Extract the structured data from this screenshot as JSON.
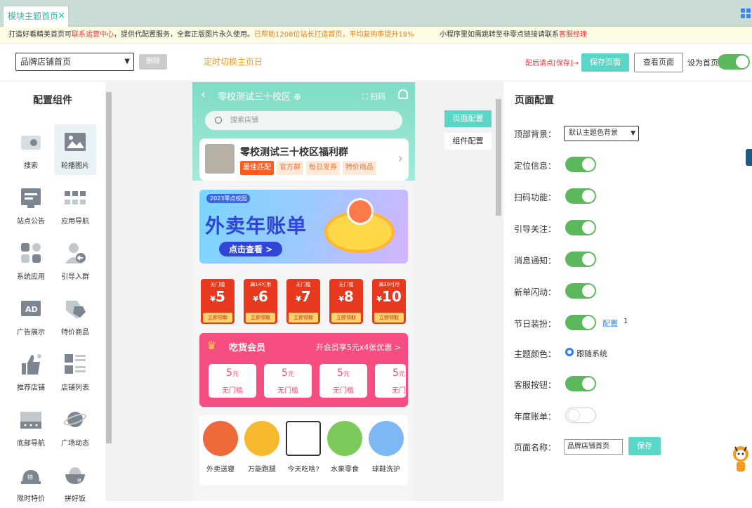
{
  "tabbar": {
    "tab_label": "模块主题首页",
    "close_glyph": "×",
    "accent": "#2bb6a8"
  },
  "notice": {
    "p1": "打造好看精美首页可",
    "p2": "联系运营中心",
    "p3": "，提供代配置服务，全套正版图片永久使用。",
    "p4": "已帮助1208位站长打造首页，平均复购率提升18%",
    "p5": "小程序里如需跳转至非零点链接请联系",
    "p6": "客服经理"
  },
  "toolbar": {
    "page_select": "品牌店铺首页",
    "delete": "删除",
    "timer_link": "定时切换主页日",
    "hint": "配后请点[保存]→",
    "save": "保存页面",
    "view": "查看页面",
    "set_home": "设为首页"
  },
  "left": {
    "title": "配置组件",
    "items": [
      {
        "label": "搜索",
        "icon": "search-component-icon"
      },
      {
        "label": "轮播图片",
        "icon": "image-carousel-icon"
      },
      {
        "label": "站点公告",
        "icon": "announcement-icon"
      },
      {
        "label": "应用导航",
        "icon": "app-nav-icon"
      },
      {
        "label": "系统应用",
        "icon": "system-app-icon"
      },
      {
        "label": "引导入群",
        "icon": "join-group-icon"
      },
      {
        "label": "广告展示",
        "icon": "ad-icon"
      },
      {
        "label": "特价商品",
        "icon": "price-tag-icon"
      },
      {
        "label": "推荐店铺",
        "icon": "thumbs-up-icon"
      },
      {
        "label": "店铺列表",
        "icon": "shop-list-icon"
      },
      {
        "label": "底部导航",
        "icon": "bottom-nav-icon"
      },
      {
        "label": "广场动态",
        "icon": "planet-icon"
      },
      {
        "label": "限时特价",
        "icon": "bell-special-icon"
      },
      {
        "label": "拼好饭",
        "icon": "bowl-icon"
      }
    ]
  },
  "phone": {
    "title": "零校测试三十校区",
    "scan": "扫码",
    "search_placeholder": "搜索店铺",
    "group_title": "零校测试三十校区福利群",
    "group_tags": [
      "最佳匹配",
      "官方群",
      "每日发券",
      "特价商品"
    ],
    "banner_sub": "2023零点校园",
    "banner_title": "外卖年账单",
    "banner_cta": "点击查看 >",
    "coupons": [
      {
        "cond": "无门槛",
        "value": "5",
        "btn": "立即领取"
      },
      {
        "cond": "满14可用",
        "value": "6",
        "btn": "立即领取"
      },
      {
        "cond": "无门槛",
        "value": "7",
        "btn": "立即领取"
      },
      {
        "cond": "无门槛",
        "value": "8",
        "btn": "立即领取"
      },
      {
        "cond": "满30可用",
        "value": "10",
        "btn": "立即领取"
      }
    ],
    "currency": "¥",
    "member_title": "吃货会员",
    "member_right": "开会员享5元x4张优惠 >",
    "member_coupons": [
      {
        "value": "5",
        "unit": "元",
        "desc": "无门槛"
      },
      {
        "value": "5",
        "unit": "元",
        "desc": "无门槛"
      },
      {
        "value": "5",
        "unit": "元",
        "desc": "无门槛"
      },
      {
        "value": "5",
        "unit": "元",
        "desc": "无门"
      }
    ],
    "services": [
      {
        "label": "外卖送寝",
        "color": "#ef6a3a"
      },
      {
        "label": "万能跑腿",
        "color": "#f7b92d"
      },
      {
        "label": "今天吃啥?",
        "color": "#ffffff"
      },
      {
        "label": "水果零食",
        "color": "#7ccb5a"
      },
      {
        "label": "球鞋洗护",
        "color": "#7db8f5"
      }
    ]
  },
  "preview_tabs": {
    "page": "页面配置",
    "component": "组件配置"
  },
  "right": {
    "title": "页面配置",
    "top_bg_label": "顶部背景：",
    "top_bg_value": "默认主题色背景",
    "location_label": "定位信息：",
    "scan_label": "扫码功能：",
    "follow_label": "引导关注：",
    "msg_label": "消息通知：",
    "flash_label": "新单闪动：",
    "festival_label": "节日装扮：",
    "festival_config": "配置",
    "festival_count": "1",
    "theme_label": "主题颜色：",
    "theme_value": "跟随系统",
    "service_label": "客服按钮：",
    "annual_label": "年度账单：",
    "name_label": "页面名称：",
    "name_value": "品牌店铺首页",
    "save": "保存"
  }
}
